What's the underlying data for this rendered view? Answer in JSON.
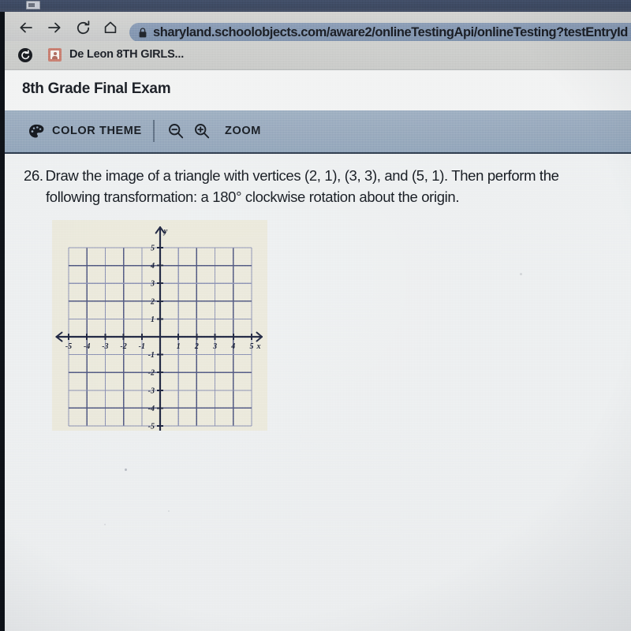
{
  "browser": {
    "nav": {
      "back": "back-arrow",
      "forward": "forward-arrow",
      "reload": "reload",
      "home": "home"
    },
    "omnibox": {
      "lock_icon": "lock-icon",
      "url": "sharyland.schoolobjects.com/aware2/onlineTestingApi/onlineTesting?testEntryId"
    },
    "bookmarks": [
      {
        "icon": "profile-circle-icon",
        "label": ""
      },
      {
        "icon": "person-badge-icon",
        "label": "De Leon 8TH GIRLS..."
      }
    ]
  },
  "exam": {
    "title": "8th Grade Final Exam",
    "toolbar": {
      "color_theme_label": "COLOR THEME",
      "color_theme_icon": "palette-icon",
      "zoom_out_icon": "magnifier-minus-icon",
      "zoom_in_icon": "magnifier-plus-icon",
      "zoom_label": "ZOOM"
    }
  },
  "question": {
    "number": "26.",
    "line1": "Draw the image of a triangle with vertices (2, 1), (3, 3), and (5, 1). Then perform the",
    "line2": "following transformation: a 180° clockwise rotation about the origin."
  },
  "chart_data": {
    "type": "scatter",
    "title": "",
    "xlabel": "x",
    "ylabel": "y",
    "xlim": [
      -5,
      5
    ],
    "ylim": [
      -5,
      5
    ],
    "xticks": [
      -5,
      -4,
      -3,
      -2,
      -1,
      1,
      2,
      3,
      4,
      5
    ],
    "yticks": [
      -5,
      -4,
      -3,
      -2,
      -1,
      1,
      2,
      3,
      4,
      5
    ],
    "xtick_labels": [
      "-5",
      "-4",
      "-3",
      "-2",
      "-1",
      "1",
      "2",
      "3",
      "4",
      "5"
    ],
    "ytick_labels": [
      "-5",
      "-4",
      "-3",
      "-2",
      "-1",
      "1",
      "2",
      "3",
      "4",
      "5"
    ],
    "grid": true,
    "grid_step": 1,
    "axes_arrows": true,
    "series": [
      {
        "name": "blank coordinate plane",
        "values": []
      }
    ]
  },
  "colors": {
    "page_background": "#eceeef",
    "toolbar_band": "#9aabbe",
    "omnibox": "#8598b2",
    "tabstrip": "#3d4961",
    "graph_card": "#ebe9dc",
    "grid_line": "#8d93b4",
    "axis_line": "#1d2440",
    "text": "#141920"
  }
}
